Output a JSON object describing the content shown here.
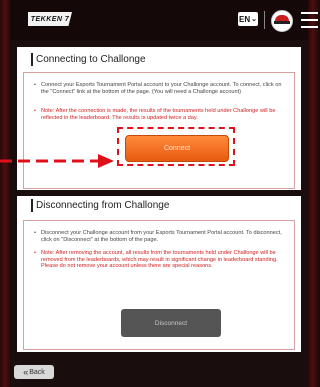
{
  "header": {
    "logo_text": "TEKKEN 7",
    "lang_label": "EN",
    "lang_chevron": "⌄"
  },
  "connect_section": {
    "title": "Connecting to Challonge",
    "bullet1": "Connect your Esports Tournament Portal account to your Challonge account. To connect, click on the \"Connect\" link at the bottom of the page. (You will need a Challonge account)",
    "note": "Note: After the connection is made, the results of the tournaments held under Challonge will be reflected in the leaderboard. The results is updated twice a day.",
    "button_label": "Connect"
  },
  "disconnect_section": {
    "title": "Disconnecting from Challonge",
    "bullet1": "Disconnect your Challonge account from your Esports Tournament Portal account. To disconnect, click on \"Disconnect\" at the bottom of the page.",
    "note": "Note: After removing the account, all results from the tournaments held under Challonge will be removed from the leaderboards, which may result in significant change in leaderboard standing. Please do not remove your account unless there are special reasons.",
    "button_label": "Disconnect"
  },
  "back_button": {
    "label": "Back",
    "icon": "«"
  },
  "colors": {
    "accent": "#f26b1d",
    "note": "#d02020",
    "highlight": "#e0101a"
  }
}
